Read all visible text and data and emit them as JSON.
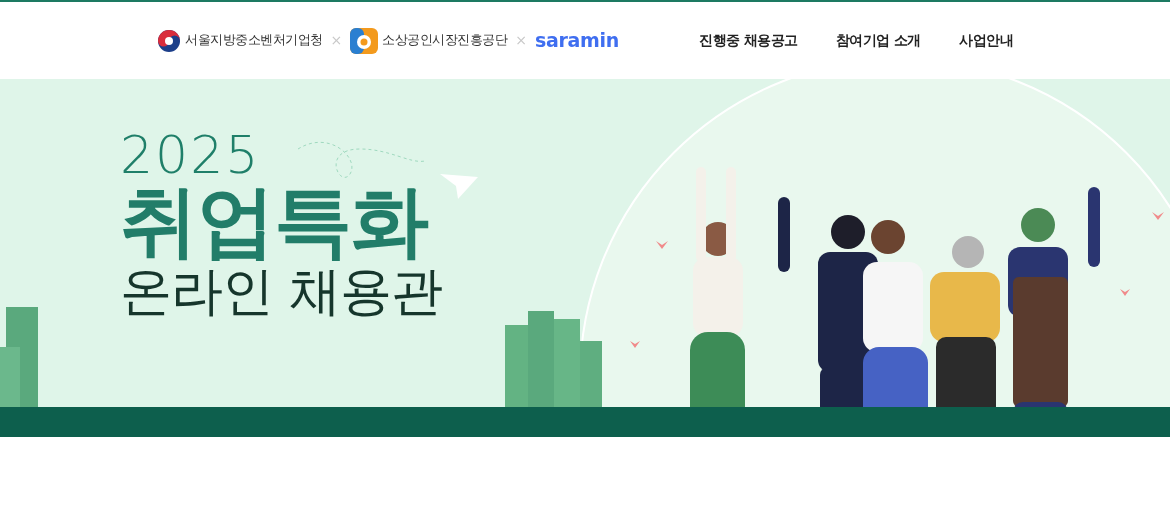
{
  "header": {
    "logos": [
      {
        "kind": "gov",
        "text": "서울지방중소벤처기업청"
      },
      {
        "kind": "sbiz",
        "text": "소상공인시장진흥공단",
        "separator": "×"
      },
      {
        "kind": "wordmark",
        "text": "saramin",
        "separator": "×"
      }
    ],
    "nav": [
      {
        "label": "진행중 채용공고"
      },
      {
        "label": "참여기업 소개"
      },
      {
        "label": "사업안내"
      }
    ]
  },
  "banner": {
    "year": "2025",
    "title": "취업특화",
    "subtitle": "온라인 채용관"
  }
}
